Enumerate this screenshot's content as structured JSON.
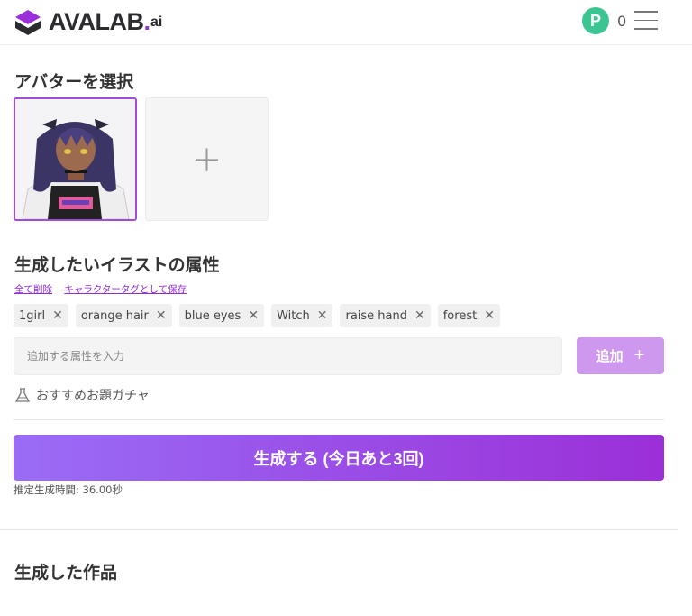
{
  "header": {
    "logo_text": "AVALAB",
    "logo_dot": ".",
    "logo_suffix": "ai",
    "points_symbol": "P",
    "points_count": "0"
  },
  "avatar_section": {
    "title": "アバターを選択",
    "add_symbol": "+"
  },
  "attributes_section": {
    "title": "生成したいイラストの属性",
    "clear_all_link": "全て削除",
    "save_as_tag_link": "キャラクタータグとして保存",
    "tags": [
      "1girl",
      "orange hair",
      "blue eyes",
      "Witch",
      "raise hand",
      "forest"
    ],
    "remove_symbol": "✕",
    "input_placeholder": "追加する属性を入力",
    "add_button_label": "追加",
    "add_button_symbol": "+",
    "gacha_label": "おすすめお題ガチャ"
  },
  "generate": {
    "button_label": "生成する (今日あと3回)",
    "estimate_text": "推定生成時間: 36.00秒"
  },
  "works_section": {
    "title": "生成した作品"
  },
  "colors": {
    "brand_purple": "#9b30d9",
    "points_green": "#3cc593",
    "add_button": "#cf98ef"
  }
}
